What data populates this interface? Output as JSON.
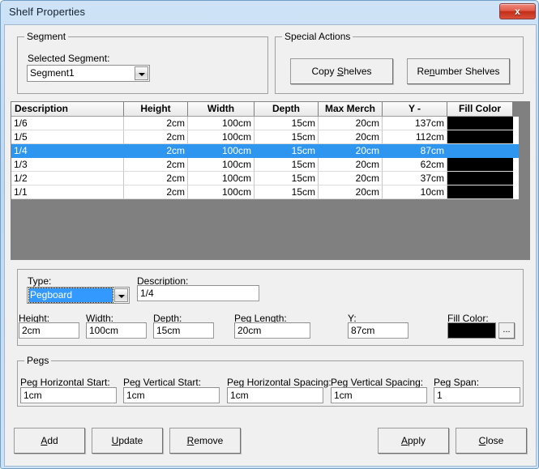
{
  "window": {
    "title": "Shelf Properties",
    "close_label": "x"
  },
  "segment_group": {
    "title": "Segment",
    "selected_segment_label": "Selected Segment:",
    "selected_segment_value": "Segment1"
  },
  "special_actions_group": {
    "title": "Special Actions",
    "copy_shelves": {
      "pre": "Copy ",
      "mnemonic": "S",
      "post": "helves"
    },
    "renumber_shelves": {
      "pre": "Re",
      "mnemonic": "n",
      "post": "umber Shelves"
    }
  },
  "grid": {
    "columns": [
      "Description",
      "Height",
      "Width",
      "Depth",
      "Max Merch",
      "Y -",
      "Fill Color"
    ],
    "selected_row_index": 2,
    "rows": [
      {
        "description": "1/6",
        "height": "2cm",
        "width": "100cm",
        "depth": "15cm",
        "max_merch": "20cm",
        "y": "137cm",
        "fill_color": "#000000"
      },
      {
        "description": "1/5",
        "height": "2cm",
        "width": "100cm",
        "depth": "15cm",
        "max_merch": "20cm",
        "y": "112cm",
        "fill_color": "#000000"
      },
      {
        "description": "1/4",
        "height": "2cm",
        "width": "100cm",
        "depth": "15cm",
        "max_merch": "20cm",
        "y": "87cm",
        "fill_color": "#000000"
      },
      {
        "description": "1/3",
        "height": "2cm",
        "width": "100cm",
        "depth": "15cm",
        "max_merch": "20cm",
        "y": "62cm",
        "fill_color": "#000000"
      },
      {
        "description": "1/2",
        "height": "2cm",
        "width": "100cm",
        "depth": "15cm",
        "max_merch": "20cm",
        "y": "37cm",
        "fill_color": "#000000"
      },
      {
        "description": "1/1",
        "height": "2cm",
        "width": "100cm",
        "depth": "15cm",
        "max_merch": "20cm",
        "y": "10cm",
        "fill_color": "#000000"
      }
    ]
  },
  "details": {
    "type_label": "Type:",
    "type_value": "Pegboard",
    "description_label": "Description:",
    "description_value": "1/4",
    "height_label": "Height:",
    "height_value": "2cm",
    "width_label": "Width:",
    "width_value": "100cm",
    "depth_label": "Depth:",
    "depth_value": "15cm",
    "peg_length_label": "Peg Length:",
    "peg_length_value": "20cm",
    "y_label": "Y:",
    "y_value": "87cm",
    "fill_color_label": "Fill Color:",
    "fill_color_value": "#000000",
    "fill_color_browse": "..."
  },
  "pegs_group": {
    "title": "Pegs",
    "peg_horizontal_start_label": "Peg Horizontal Start:",
    "peg_horizontal_start_value": "1cm",
    "peg_vertical_start_label": "Peg Vertical Start:",
    "peg_vertical_start_value": "1cm",
    "peg_horizontal_spacing_label": "Peg Horizontal Spacing:",
    "peg_horizontal_spacing_value": "1cm",
    "peg_vertical_spacing_label": "Peg Vertical Spacing:",
    "peg_vertical_spacing_value": "1cm",
    "peg_span_label": "Peg Span:",
    "peg_span_value": "1"
  },
  "footer": {
    "add": {
      "pre": "",
      "mnemonic": "A",
      "post": "dd"
    },
    "update": {
      "pre": "",
      "mnemonic": "U",
      "post": "pdate"
    },
    "remove": {
      "pre": "",
      "mnemonic": "R",
      "post": "emove"
    },
    "apply": {
      "pre": "",
      "mnemonic": "A",
      "post": "pply"
    },
    "close": {
      "pre": "",
      "mnemonic": "C",
      "post": "lose"
    }
  },
  "colors": {
    "selection_blue": "#2f96f0",
    "dialog_face": "#f0f0f0",
    "grid_background": "#808080",
    "title_bar": "#cfe3f7"
  }
}
